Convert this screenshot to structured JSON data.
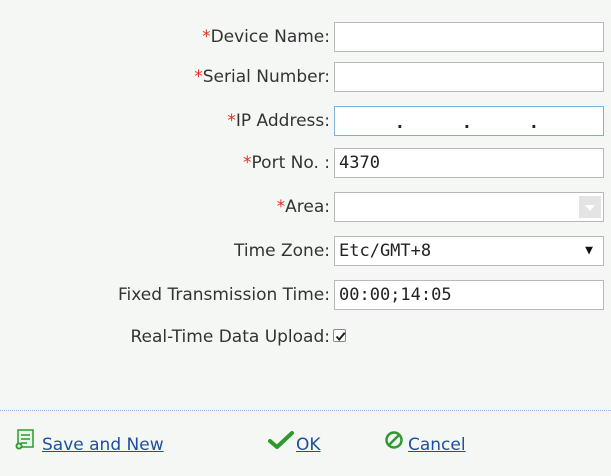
{
  "form": {
    "device_name": {
      "required_mark": "*",
      "label": "Device Name:",
      "value": ""
    },
    "serial_number": {
      "required_mark": "*",
      "label": "Serial Number:",
      "value": ""
    },
    "ip_address": {
      "required_mark": "*",
      "label": "IP Address:",
      "octets": [
        "",
        "",
        "",
        ""
      ],
      "separator": "."
    },
    "port_no": {
      "required_mark": "*",
      "label": "Port No. :",
      "value": "4370"
    },
    "area": {
      "required_mark": "*",
      "label": "Area:",
      "value": ""
    },
    "time_zone": {
      "label": "Time Zone:",
      "value": "Etc/GMT+8",
      "caret": "▼"
    },
    "fixed_transmission_time": {
      "label": "Fixed Transmission Time:",
      "value": "00:00;14:05"
    },
    "real_time_upload": {
      "label": "Real-Time Data Upload:",
      "checked": true
    }
  },
  "footer": {
    "save_new_label": "Save and New",
    "ok_label": "OK",
    "cancel_label": "Cancel"
  },
  "colors": {
    "required": "#e0301e",
    "link": "#1f4fa0",
    "ok_check": "#2e9a2e",
    "cancel_icon": "#2e9a2e",
    "save_icon": "#2e9a2e"
  },
  "icons": {
    "save": "save-new-icon",
    "ok": "check-icon",
    "cancel": "cancel-icon",
    "checkbox": "checkmark-icon"
  }
}
